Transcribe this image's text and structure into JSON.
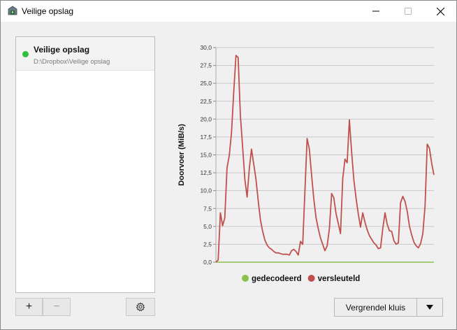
{
  "window": {
    "title": "Veilige opslag",
    "icon": "vault-icon",
    "controls": {
      "minimize": "minimize-icon",
      "maximize": "maximize-icon",
      "close": "close-icon"
    }
  },
  "vaults": [
    {
      "name": "Veilige opslag",
      "path": "D:\\Dropbox\\Veilige opslag",
      "status": "unlocked",
      "status_color": "#2fbf3a"
    }
  ],
  "list_controls": {
    "add_label": "+",
    "remove_label": "−",
    "settings_icon": "gear-icon"
  },
  "actions": {
    "lock_label": "Vergrendel kluis",
    "menu_icon": "triangle-down-icon"
  },
  "chart_data": {
    "type": "line",
    "ylabel": "Doorvoer (MiB/s)",
    "xlabel": "",
    "ylim": [
      0,
      30
    ],
    "yticks": [
      "0,0",
      "2,5",
      "5,0",
      "7,5",
      "10,0",
      "12,5",
      "15,0",
      "17,5",
      "20,0",
      "22,5",
      "25,0",
      "27,5",
      "30,0"
    ],
    "grid": true,
    "legend_position": "bottom",
    "series": [
      {
        "name": "gedecodeerd",
        "color": "#8bc34a",
        "values": [
          0,
          0,
          0,
          0,
          0,
          0,
          0,
          0,
          0,
          0,
          0,
          0,
          0,
          0,
          0,
          0,
          0,
          0,
          0,
          0,
          0,
          0,
          0,
          0,
          0,
          0,
          0,
          0,
          0,
          0,
          0,
          0,
          0,
          0,
          0,
          0,
          0,
          0,
          0,
          0,
          0,
          0,
          0,
          0,
          0,
          0,
          0,
          0,
          0,
          0,
          0,
          0,
          0,
          0,
          0,
          0,
          0,
          0,
          0,
          0,
          0,
          0,
          0,
          0,
          0,
          0,
          0,
          0,
          0,
          0,
          0,
          0,
          0,
          0,
          0,
          0,
          0,
          0,
          0,
          0,
          0,
          0,
          0,
          0,
          0,
          0,
          0,
          0,
          0,
          0,
          0,
          0,
          0,
          0,
          0,
          0,
          0,
          0,
          0,
          0
        ]
      },
      {
        "name": "versleuteld",
        "color": "#c0504d",
        "values": [
          0,
          0.3,
          6.9,
          5.1,
          6.2,
          13.2,
          14.9,
          18.1,
          23.8,
          28.9,
          28.6,
          20.5,
          16.1,
          11.6,
          9.1,
          13.1,
          15.8,
          13.7,
          11.6,
          8.6,
          5.9,
          4.3,
          3.1,
          2.4,
          2.0,
          1.8,
          1.5,
          1.3,
          1.3,
          1.2,
          1.1,
          1.1,
          1.1,
          1.0,
          1.6,
          1.8,
          1.5,
          1.0,
          2.9,
          2.5,
          9.8,
          17.3,
          15.8,
          12.2,
          8.8,
          6.2,
          4.7,
          3.4,
          2.5,
          1.6,
          2.3,
          4.7,
          9.6,
          9.0,
          6.8,
          5.4,
          4.0,
          11.7,
          14.4,
          13.9,
          19.9,
          15.4,
          11.5,
          8.9,
          6.7,
          4.9,
          6.9,
          5.6,
          4.5,
          3.7,
          3.2,
          2.7,
          2.4,
          1.9,
          2.0,
          4.7,
          6.9,
          5.3,
          4.4,
          4.3,
          3.0,
          2.5,
          2.7,
          8.3,
          9.2,
          8.5,
          7.1,
          5.0,
          3.8,
          2.8,
          2.3,
          2.0,
          2.6,
          4.0,
          7.9,
          16.5,
          15.9,
          13.8,
          12.2
        ]
      }
    ]
  }
}
